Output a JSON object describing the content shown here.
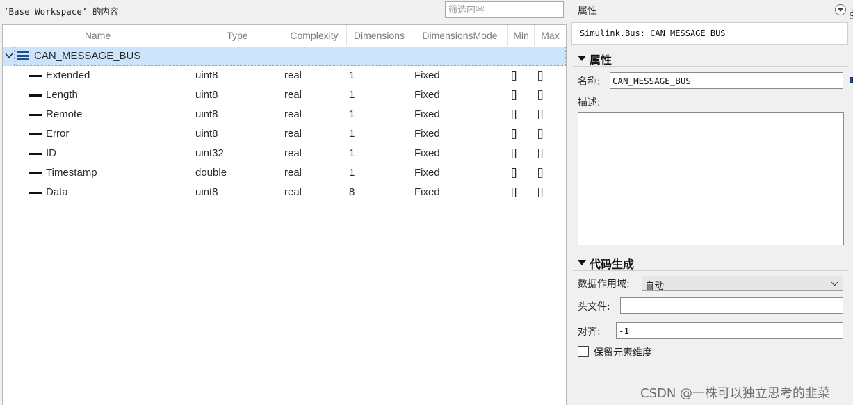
{
  "workspace": {
    "title": "’Base Workspace’ 的内容",
    "filter_placeholder": "筛选内容"
  },
  "columns": [
    "Name",
    "Type",
    "Complexity",
    "Dimensions",
    "DimensionsMode",
    "Min",
    "Max"
  ],
  "tree": {
    "root": {
      "name": "CAN_MESSAGE_BUS",
      "icon": "bus-icon",
      "expanded": true
    },
    "children": [
      {
        "name": "Extended",
        "type": "uint8",
        "complexity": "real",
        "dimensions": "1",
        "mode": "Fixed",
        "min": "[]",
        "max": "[]"
      },
      {
        "name": "Length",
        "type": "uint8",
        "complexity": "real",
        "dimensions": "1",
        "mode": "Fixed",
        "min": "[]",
        "max": "[]"
      },
      {
        "name": "Remote",
        "type": "uint8",
        "complexity": "real",
        "dimensions": "1",
        "mode": "Fixed",
        "min": "[]",
        "max": "[]"
      },
      {
        "name": "Error",
        "type": "uint8",
        "complexity": "real",
        "dimensions": "1",
        "mode": "Fixed",
        "min": "[]",
        "max": "[]"
      },
      {
        "name": "ID",
        "type": "uint32",
        "complexity": "real",
        "dimensions": "1",
        "mode": "Fixed",
        "min": "[]",
        "max": "[]"
      },
      {
        "name": "Timestamp",
        "type": "double",
        "complexity": "real",
        "dimensions": "1",
        "mode": "Fixed",
        "min": "[]",
        "max": "[]"
      },
      {
        "name": "Data",
        "type": "uint8",
        "complexity": "real",
        "dimensions": "8",
        "mode": "Fixed",
        "min": "[]",
        "max": "[]"
      }
    ]
  },
  "properties": {
    "panel_title": "属性",
    "object_label": "Simulink.Bus: CAN_MESSAGE_BUS",
    "section_attributes": "属性",
    "name_label": "名称:",
    "name_value": "CAN_MESSAGE_BUS",
    "desc_label": "描述:",
    "section_codegen": "代码生成",
    "scope_label": "数据作用域:",
    "scope_value": "自动",
    "header_label": "头文件:",
    "header_value": "",
    "align_label": "对齐:",
    "align_value": "-1",
    "preserve_label": "保留元素维度",
    "preserve_checked": false
  },
  "watermark": "CSDN @一株可以独立思考的韭菜",
  "colors": {
    "selection": "#cce4fb",
    "bus_icon": "#1e4f8c"
  }
}
